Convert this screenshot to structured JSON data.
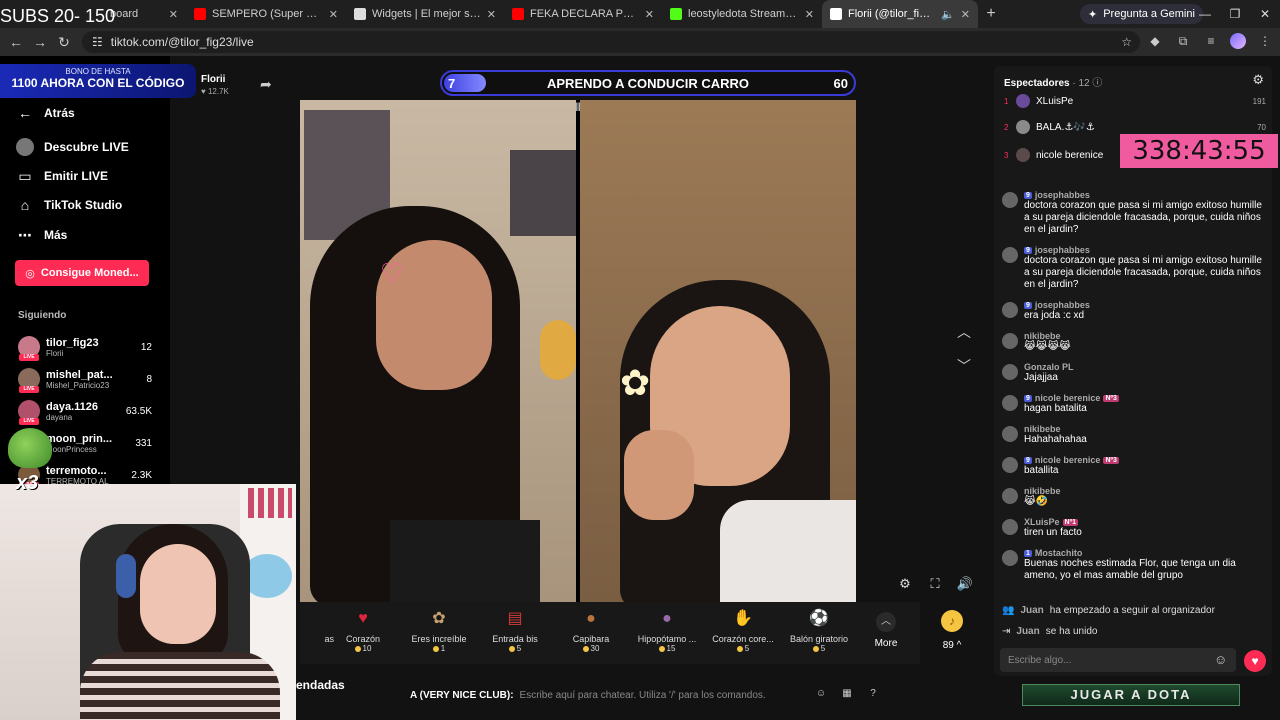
{
  "overlay": {
    "subs_text": "SUBS 20- 150",
    "promo_line1": "BONO DE HASTA",
    "promo_line2": "1100 AHORA CON EL CÓDIGO",
    "multiplier": "x3",
    "timer": "338:43:55",
    "dota_banner": "JUGAR A DOTA"
  },
  "browser": {
    "tabs": [
      {
        "title": "board",
        "favicon_color": "#6b6b6b"
      },
      {
        "title": "SEMPERO (Super Slowed) - You",
        "favicon_color": "#ff0000"
      },
      {
        "title": "Widgets | El mejor software pa",
        "favicon_color": "#dddddd"
      },
      {
        "title": "FEKA DECLARA POR VIDEO",
        "favicon_color": "#ff0000"
      },
      {
        "title": "leostyledota Stream - Watch Li",
        "favicon_color": "#53fc18"
      },
      {
        "title": "Florii (@tilor_fig23) está",
        "favicon_color": "#ffffff",
        "active": true
      }
    ],
    "new_tab": "+",
    "gemini_label": "Pregunta a Gemini",
    "url": "tiktok.com/@tilor_fig23/live"
  },
  "sidebar": {
    "back": "Atrás",
    "items": [
      {
        "label": "Descubre LIVE"
      },
      {
        "label": "Emitir LIVE"
      },
      {
        "label": "TikTok Studio"
      },
      {
        "label": "Más"
      }
    ],
    "coins_button": "Consigue Moned...",
    "following_header": "Siguiendo",
    "following": [
      {
        "name": "tilor_fig23",
        "sub": "Florii",
        "count": "12",
        "color": "#c97a8a"
      },
      {
        "name": "mishel_pat...",
        "sub": "Mishel_Patricio23",
        "count": "8",
        "color": "#8a6a5a"
      },
      {
        "name": "daya.1126",
        "sub": "dayana",
        "count": "63.5K",
        "color": "#b0506a"
      },
      {
        "name": "moon_prin...",
        "sub": "MoonPrincess",
        "count": "331",
        "color": "#6a6a9a"
      },
      {
        "name": "terremoto...",
        "sub": "TERREMOTO AL",
        "count": "2.3K",
        "color": "#7a5a3a"
      }
    ]
  },
  "stream": {
    "host_name": "Florii",
    "host_likes": "12.7K",
    "battle": {
      "left_score": "7",
      "title": "APRENDO A CONDUCIR CARRO",
      "right_score": "60",
      "left_fraction": 0.104
    },
    "watermark": "Mishel_Patricio23",
    "recommended_label": "endadas"
  },
  "gifts": [
    {
      "name": "as",
      "price": "",
      "icon": "",
      "color": "#181818"
    },
    {
      "name": "Corazón",
      "price": "10",
      "icon": "♥",
      "color": "#e0263b"
    },
    {
      "name": "Eres increíble",
      "price": "1",
      "icon": "✿",
      "color": "#c8a070"
    },
    {
      "name": "Entrada bis",
      "price": "5",
      "icon": "▤",
      "color": "#d23b3b"
    },
    {
      "name": "Capibara",
      "price": "30",
      "icon": "●",
      "color": "#b8743e"
    },
    {
      "name": "Hipopótamo ...",
      "price": "15",
      "icon": "●",
      "color": "#9a6aa8"
    },
    {
      "name": "Corazón core...",
      "price": "5",
      "icon": "✋",
      "color": "#e8a080"
    },
    {
      "name": "Balón giratorio",
      "price": "5",
      "icon": "⚽",
      "color": "#ffffff"
    }
  ],
  "more_label": "More",
  "coin_balance": "89",
  "chatbar": {
    "who": "A (VERY NICE CLUB):",
    "placeholder": "Escribe aquí para chatear. Utiliza '/' para los comandos."
  },
  "chat": {
    "viewers_label": "Espectadores",
    "viewers_count": "· 12",
    "top_viewers": [
      {
        "rank": "1",
        "name": "XLuisPe",
        "count": "191"
      },
      {
        "rank": "2",
        "name": "BALA.⚓🎶⚓",
        "count": "70"
      },
      {
        "rank": "3",
        "name": "nicole berenice",
        "count": ""
      }
    ],
    "messages": [
      {
        "user": "josephabbes",
        "badge": "9",
        "text": "doctora corazon que pasa si mi amigo exitoso humille a su pareja diciendole fracasada, porque, cuida niños en el jardin?"
      },
      {
        "user": "josephabbes",
        "badge": "9",
        "text": "doctora corazon que pasa si mi amigo exitoso humille a su pareja diciendole fracasada, porque, cuida niños en el jardin?"
      },
      {
        "user": "josephabbes",
        "badge": "9",
        "text": "era joda :c xd"
      },
      {
        "user": "nikibebe",
        "badge": "",
        "text": "😹😹😹😹"
      },
      {
        "user": "Gonzalo PL",
        "badge": "",
        "text": "Jajajjaa"
      },
      {
        "user": "nicole berenice",
        "badge": "9",
        "rank_badge": "Nº3",
        "text": "hagan batalita"
      },
      {
        "user": "nikibebe",
        "badge": "",
        "text": "Hahahahahaa"
      },
      {
        "user": "nicole berenice",
        "badge": "9",
        "rank_badge": "Nº3",
        "text": "batallita"
      },
      {
        "user": "nikibebe",
        "badge": "",
        "text": "😹🤣"
      },
      {
        "user": "XLuisPe",
        "badge": "",
        "rank_badge": "Nº1",
        "text": "tiren un facto"
      },
      {
        "user": "Mostachito",
        "badge": "1",
        "text": "Buenas noches estimada Flor, que tenga un dia ameno, yo el mas amable del grupo"
      }
    ],
    "system": [
      {
        "user": "Juan",
        "text": "ha empezado a seguir al organizador"
      },
      {
        "user": "Juan",
        "text": "se ha unido"
      }
    ],
    "input_placeholder": "Escribe algo..."
  }
}
